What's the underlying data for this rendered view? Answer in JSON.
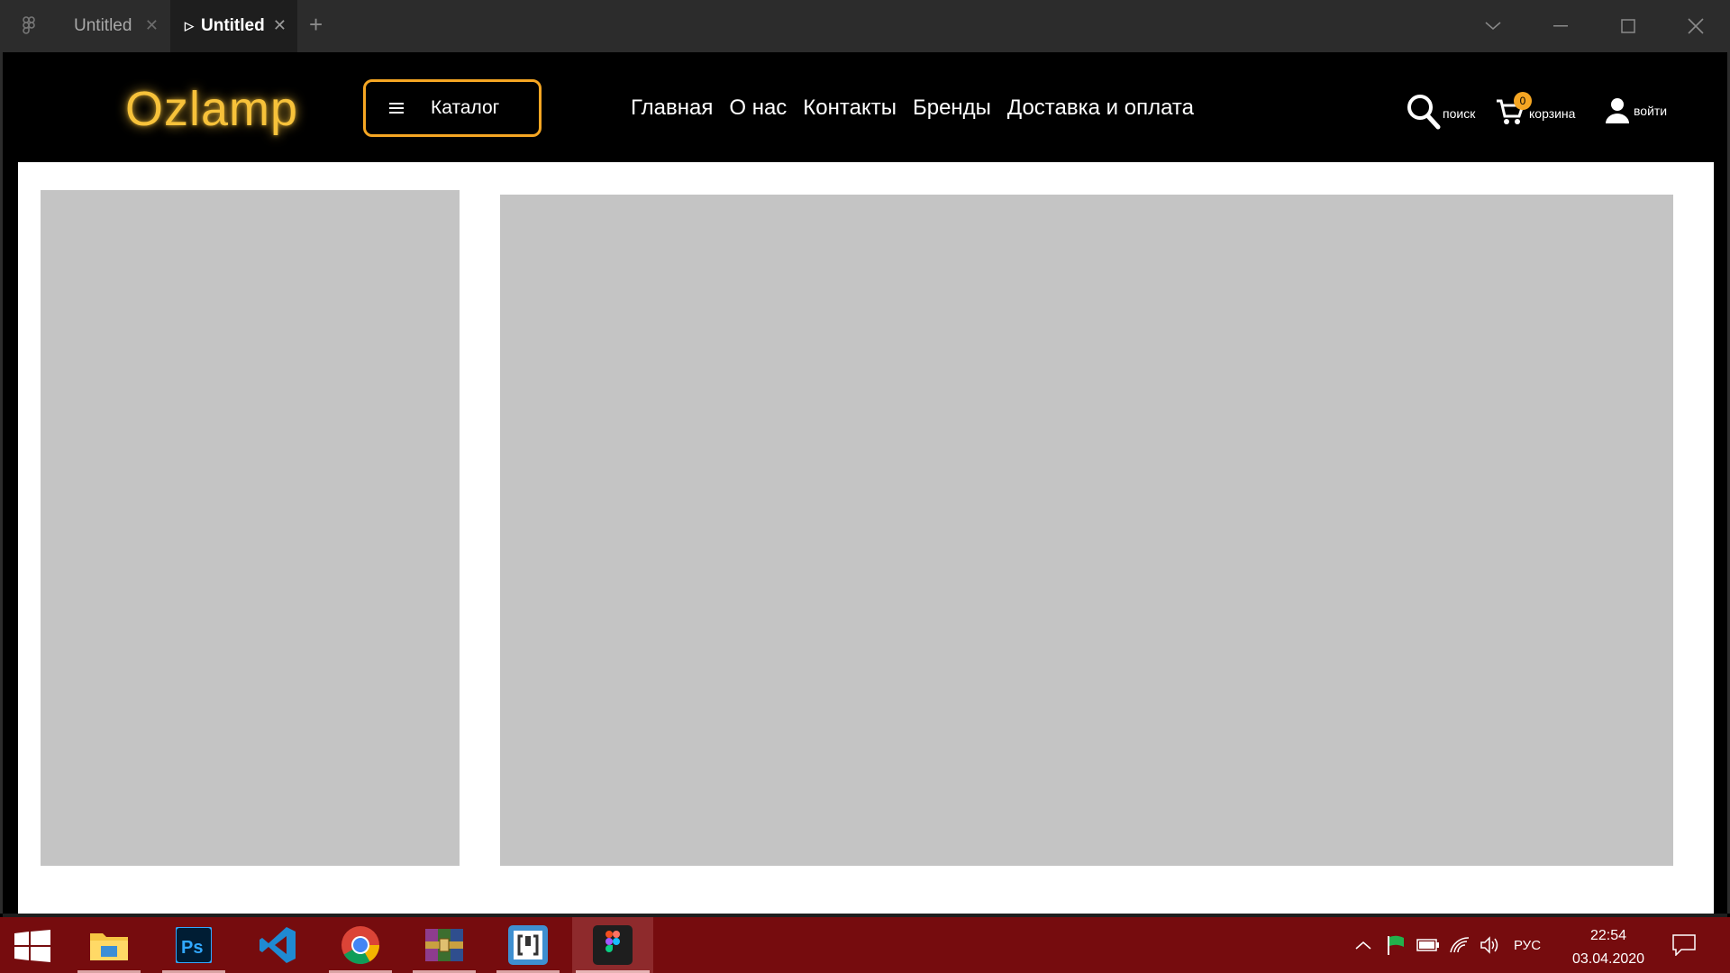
{
  "titlebar": {
    "tabs": [
      {
        "label": "Untitled",
        "active": false
      },
      {
        "label": "Untitled",
        "active": true
      }
    ],
    "new_tab": "+"
  },
  "site": {
    "logo": "Ozlamp",
    "catalog_label": "Каталог",
    "nav": [
      "Главная",
      "О нас",
      "Контакты",
      "Бренды",
      "Доставка и оплата"
    ],
    "search_label": "поиск",
    "cart_label": "корзина",
    "cart_count": "0",
    "login_label": "войти",
    "accent_color": "#f5a623",
    "logo_color": "#f7c23a"
  },
  "taskbar": {
    "apps": [
      "file-explorer",
      "photoshop",
      "vs-code",
      "chrome",
      "winrar",
      "brackets",
      "figma"
    ],
    "active_app": "figma",
    "language": "РУС",
    "time": "22:54",
    "date": "03.04.2020",
    "color": "#760c0e"
  }
}
